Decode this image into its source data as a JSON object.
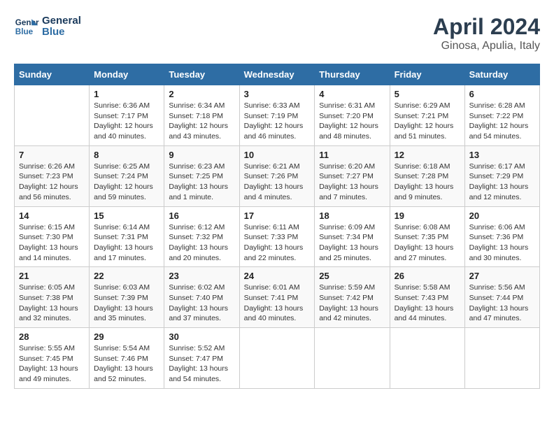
{
  "header": {
    "logo_line1": "General",
    "logo_line2": "Blue",
    "title": "April 2024",
    "location": "Ginosa, Apulia, Italy"
  },
  "weekdays": [
    "Sunday",
    "Monday",
    "Tuesday",
    "Wednesday",
    "Thursday",
    "Friday",
    "Saturday"
  ],
  "weeks": [
    [
      {
        "day": "",
        "sunrise": "",
        "sunset": "",
        "daylight": ""
      },
      {
        "day": "1",
        "sunrise": "Sunrise: 6:36 AM",
        "sunset": "Sunset: 7:17 PM",
        "daylight": "Daylight: 12 hours and 40 minutes."
      },
      {
        "day": "2",
        "sunrise": "Sunrise: 6:34 AM",
        "sunset": "Sunset: 7:18 PM",
        "daylight": "Daylight: 12 hours and 43 minutes."
      },
      {
        "day": "3",
        "sunrise": "Sunrise: 6:33 AM",
        "sunset": "Sunset: 7:19 PM",
        "daylight": "Daylight: 12 hours and 46 minutes."
      },
      {
        "day": "4",
        "sunrise": "Sunrise: 6:31 AM",
        "sunset": "Sunset: 7:20 PM",
        "daylight": "Daylight: 12 hours and 48 minutes."
      },
      {
        "day": "5",
        "sunrise": "Sunrise: 6:29 AM",
        "sunset": "Sunset: 7:21 PM",
        "daylight": "Daylight: 12 hours and 51 minutes."
      },
      {
        "day": "6",
        "sunrise": "Sunrise: 6:28 AM",
        "sunset": "Sunset: 7:22 PM",
        "daylight": "Daylight: 12 hours and 54 minutes."
      }
    ],
    [
      {
        "day": "7",
        "sunrise": "Sunrise: 6:26 AM",
        "sunset": "Sunset: 7:23 PM",
        "daylight": "Daylight: 12 hours and 56 minutes."
      },
      {
        "day": "8",
        "sunrise": "Sunrise: 6:25 AM",
        "sunset": "Sunset: 7:24 PM",
        "daylight": "Daylight: 12 hours and 59 minutes."
      },
      {
        "day": "9",
        "sunrise": "Sunrise: 6:23 AM",
        "sunset": "Sunset: 7:25 PM",
        "daylight": "Daylight: 13 hours and 1 minute."
      },
      {
        "day": "10",
        "sunrise": "Sunrise: 6:21 AM",
        "sunset": "Sunset: 7:26 PM",
        "daylight": "Daylight: 13 hours and 4 minutes."
      },
      {
        "day": "11",
        "sunrise": "Sunrise: 6:20 AM",
        "sunset": "Sunset: 7:27 PM",
        "daylight": "Daylight: 13 hours and 7 minutes."
      },
      {
        "day": "12",
        "sunrise": "Sunrise: 6:18 AM",
        "sunset": "Sunset: 7:28 PM",
        "daylight": "Daylight: 13 hours and 9 minutes."
      },
      {
        "day": "13",
        "sunrise": "Sunrise: 6:17 AM",
        "sunset": "Sunset: 7:29 PM",
        "daylight": "Daylight: 13 hours and 12 minutes."
      }
    ],
    [
      {
        "day": "14",
        "sunrise": "Sunrise: 6:15 AM",
        "sunset": "Sunset: 7:30 PM",
        "daylight": "Daylight: 13 hours and 14 minutes."
      },
      {
        "day": "15",
        "sunrise": "Sunrise: 6:14 AM",
        "sunset": "Sunset: 7:31 PM",
        "daylight": "Daylight: 13 hours and 17 minutes."
      },
      {
        "day": "16",
        "sunrise": "Sunrise: 6:12 AM",
        "sunset": "Sunset: 7:32 PM",
        "daylight": "Daylight: 13 hours and 20 minutes."
      },
      {
        "day": "17",
        "sunrise": "Sunrise: 6:11 AM",
        "sunset": "Sunset: 7:33 PM",
        "daylight": "Daylight: 13 hours and 22 minutes."
      },
      {
        "day": "18",
        "sunrise": "Sunrise: 6:09 AM",
        "sunset": "Sunset: 7:34 PM",
        "daylight": "Daylight: 13 hours and 25 minutes."
      },
      {
        "day": "19",
        "sunrise": "Sunrise: 6:08 AM",
        "sunset": "Sunset: 7:35 PM",
        "daylight": "Daylight: 13 hours and 27 minutes."
      },
      {
        "day": "20",
        "sunrise": "Sunrise: 6:06 AM",
        "sunset": "Sunset: 7:36 PM",
        "daylight": "Daylight: 13 hours and 30 minutes."
      }
    ],
    [
      {
        "day": "21",
        "sunrise": "Sunrise: 6:05 AM",
        "sunset": "Sunset: 7:38 PM",
        "daylight": "Daylight: 13 hours and 32 minutes."
      },
      {
        "day": "22",
        "sunrise": "Sunrise: 6:03 AM",
        "sunset": "Sunset: 7:39 PM",
        "daylight": "Daylight: 13 hours and 35 minutes."
      },
      {
        "day": "23",
        "sunrise": "Sunrise: 6:02 AM",
        "sunset": "Sunset: 7:40 PM",
        "daylight": "Daylight: 13 hours and 37 minutes."
      },
      {
        "day": "24",
        "sunrise": "Sunrise: 6:01 AM",
        "sunset": "Sunset: 7:41 PM",
        "daylight": "Daylight: 13 hours and 40 minutes."
      },
      {
        "day": "25",
        "sunrise": "Sunrise: 5:59 AM",
        "sunset": "Sunset: 7:42 PM",
        "daylight": "Daylight: 13 hours and 42 minutes."
      },
      {
        "day": "26",
        "sunrise": "Sunrise: 5:58 AM",
        "sunset": "Sunset: 7:43 PM",
        "daylight": "Daylight: 13 hours and 44 minutes."
      },
      {
        "day": "27",
        "sunrise": "Sunrise: 5:56 AM",
        "sunset": "Sunset: 7:44 PM",
        "daylight": "Daylight: 13 hours and 47 minutes."
      }
    ],
    [
      {
        "day": "28",
        "sunrise": "Sunrise: 5:55 AM",
        "sunset": "Sunset: 7:45 PM",
        "daylight": "Daylight: 13 hours and 49 minutes."
      },
      {
        "day": "29",
        "sunrise": "Sunrise: 5:54 AM",
        "sunset": "Sunset: 7:46 PM",
        "daylight": "Daylight: 13 hours and 52 minutes."
      },
      {
        "day": "30",
        "sunrise": "Sunrise: 5:52 AM",
        "sunset": "Sunset: 7:47 PM",
        "daylight": "Daylight: 13 hours and 54 minutes."
      },
      {
        "day": "",
        "sunrise": "",
        "sunset": "",
        "daylight": ""
      },
      {
        "day": "",
        "sunrise": "",
        "sunset": "",
        "daylight": ""
      },
      {
        "day": "",
        "sunrise": "",
        "sunset": "",
        "daylight": ""
      },
      {
        "day": "",
        "sunrise": "",
        "sunset": "",
        "daylight": ""
      }
    ]
  ]
}
